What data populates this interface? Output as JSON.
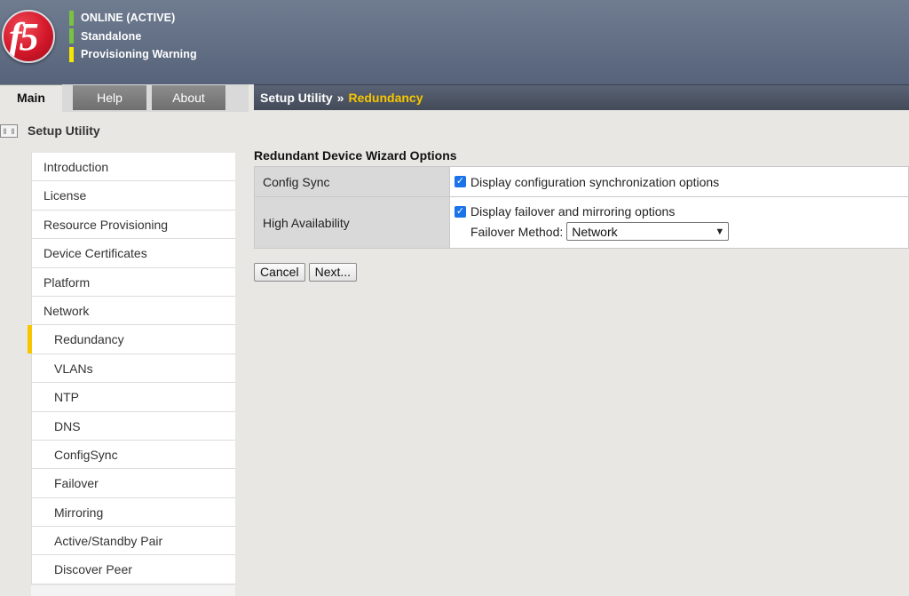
{
  "header": {
    "logo_text": "f5",
    "status": [
      {
        "text": "ONLINE (ACTIVE)",
        "color": "#7bc142"
      },
      {
        "text": "Standalone",
        "color": "#7bc142"
      },
      {
        "text": "Provisioning Warning",
        "color": "#f7e600"
      }
    ]
  },
  "tabs": [
    {
      "label": "Main",
      "active": true
    },
    {
      "label": "Help",
      "active": false
    },
    {
      "label": "About",
      "active": false
    }
  ],
  "breadcrumb": {
    "root": "Setup Utility",
    "separator": "»",
    "current": "Redundancy"
  },
  "sidebar": {
    "title": "Setup Utility",
    "items": [
      {
        "label": "Introduction"
      },
      {
        "label": "License"
      },
      {
        "label": "Resource Provisioning"
      },
      {
        "label": "Device Certificates"
      },
      {
        "label": "Platform"
      },
      {
        "label": "Network"
      },
      {
        "label": "Redundancy",
        "selected": true
      },
      {
        "label": "VLANs"
      },
      {
        "label": "NTP"
      },
      {
        "label": "DNS"
      },
      {
        "label": "ConfigSync"
      },
      {
        "label": "Failover"
      },
      {
        "label": "Mirroring"
      },
      {
        "label": "Active/Standby Pair"
      },
      {
        "label": "Discover Peer"
      }
    ]
  },
  "main": {
    "section_title": "Redundant Device Wizard Options",
    "config_sync": {
      "label": "Config Sync",
      "checkbox_label": "Display configuration synchronization options",
      "checked": true
    },
    "high_availability": {
      "label": "High Availability",
      "checkbox_label": "Display failover and mirroring options",
      "checked": true,
      "failover_method_label": "Failover Method:",
      "failover_method_value": "Network"
    },
    "buttons": {
      "cancel": "Cancel",
      "next": "Next..."
    }
  },
  "colors": {
    "accent": "#f7c600",
    "checkbox": "#1a73e8"
  }
}
